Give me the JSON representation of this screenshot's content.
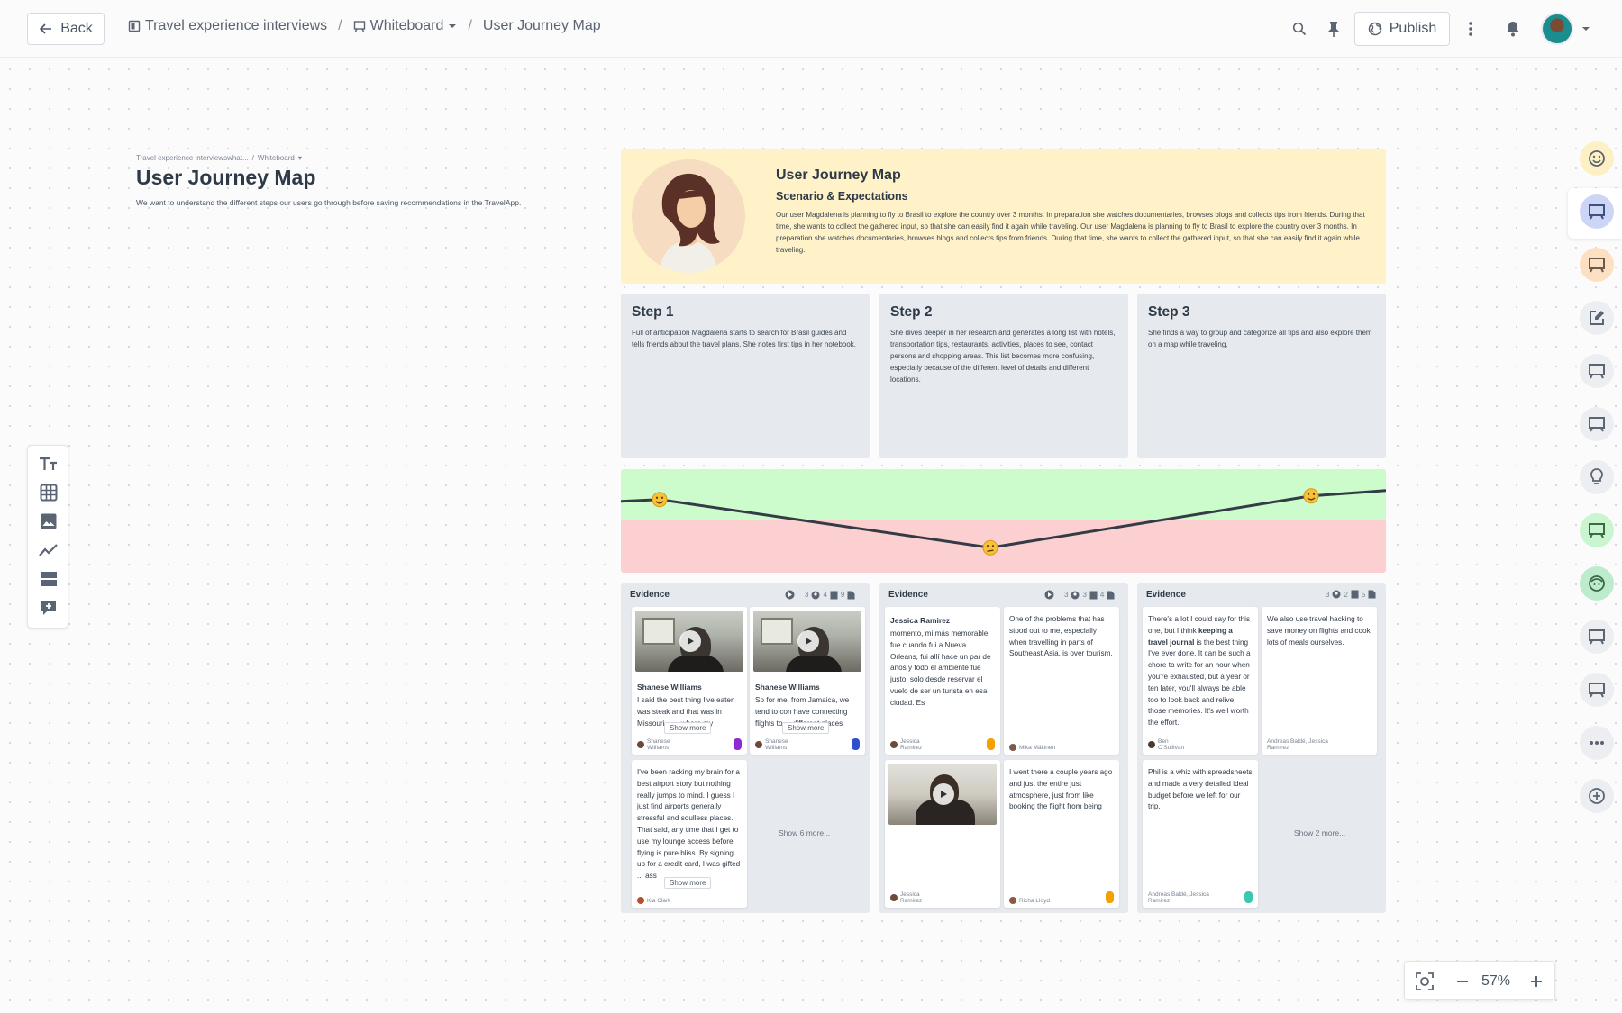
{
  "topbar": {
    "back_label": "Back",
    "breadcrumbs": [
      "Travel experience interviews",
      "Whiteboard",
      "User Journey Map"
    ],
    "publish_label": "Publish"
  },
  "page": {
    "mini_crumbs": [
      "Travel experience interviewswhat...",
      "Whiteboard"
    ],
    "title": "User Journey Map",
    "description": "We want to understand the different steps our users go through before saving recommendations in the TravelApp."
  },
  "scenario": {
    "title": "User Journey Map",
    "subtitle": "Scenario & Expectations",
    "text": "Our user Magdalena is planning to fly to Brasil to explore the country over 3 months. In preparation she watches documentaries, browses blogs and collects tips from friends. During that time, she wants to collect the gathered input, so that she can easily find it again while traveling. Our user Magdalena is planning to fly to Brasil to explore the country over 3 months. In  preparation she watches documentaries, browses blogs and collects tips from friends. During that time, she wants to collect the gathered input, so that she can easily find it again while traveling."
  },
  "steps": [
    {
      "title": "Step 1",
      "text": "Full of anticipation Magdalena starts to search for Brasil guides and tells friends about the travel plans. She notes first tips in her notebook."
    },
    {
      "title": "Step 2",
      "text": "She dives deeper in her research and generates a long list with hotels, transportation tips, restaurants, activities, places to see, contact persons and shopping areas. This list becomes more confusing, especially because of the different level of details and different locations."
    },
    {
      "title": "Step 3",
      "text": "She finds a way to group and categorize all tips and also explore them on a map while traveling."
    }
  ],
  "emotion_curve": {
    "values": [
      0.74,
      0.2,
      0.78
    ]
  },
  "evidence": [
    {
      "title": "Evidence",
      "meta": {
        "videos": "",
        "people": "3",
        "people2": "4",
        "notes": "9"
      },
      "cards": [
        {
          "author": "Shanese Williams",
          "text": "I said the best thing I've eaten was steak and that was in Missouri, , ... where my",
          "foot": "Shanese Williams",
          "show_more": "Show more"
        },
        {
          "author": "Shanese Williams",
          "text": "So for me, from Jamaica, we tend to con have connecting flights to ... different places",
          "foot": "Shanese Williams",
          "show_more": "Show more"
        },
        {
          "text": "I've been racking my brain for a best airport story but nothing really jumps to mind. I guess I just find airports generally stressful and soulless places. That said, any time that I get to use my lounge access before flying is pure bliss. By signing up for a credit card, I was gifted ... ass",
          "foot": "Kia Clark",
          "show_more": "Show more"
        }
      ],
      "show_more_link": "Show 6 more..."
    },
    {
      "title": "Evidence",
      "meta": {
        "people": "3",
        "people2": "3",
        "notes": "4"
      },
      "cards": [
        {
          "author": "Jessica Ramirez",
          "text": "momento, mi más memorable fue cuando fui a Nueva Orleans, fui allí hace un par de años y todo el ambiente fue justo, solo desde reservar el vuelo de ser un turista en esa ciudad. Es",
          "foot": "Jessica Ramirez"
        },
        {
          "text": "One of the problems that has stood out to me, especially when travelling in parts of Southeast Asia, is over tourism.",
          "foot": "Mika Mäkinen"
        },
        {
          "text": "",
          "foot": "Jessica Ramirez"
        },
        {
          "text": "I went there a couple years ago and just the entire just atmosphere, just from like booking the flight from being",
          "foot": "Richa Lloyd"
        }
      ]
    },
    {
      "title": "Evidence",
      "meta": {
        "people": "3",
        "people2": "2",
        "notes": "5"
      },
      "cards": [
        {
          "text_before": "There's a lot I could say for this one, but I think ",
          "text_bold": "keeping a travel journal",
          "text_after": " is the best thing I've ever done. It can be such a chore to write for an hour when you're exhausted, but a year or ten later, you'll always be able too to look back and relive those memories. It's well worth the effort.",
          "foot": "Ben O'Sullivan"
        },
        {
          "text": "We also use travel hacking to save money on flights and cook lots of meals ourselves.",
          "foot": "Andreas Baldé, Jessica Ramirez"
        },
        {
          "text": "Phil is a whiz with spreadsheets and made a very detailed ideal budget before we left for our trip.",
          "foot": "Andreas Baldé, Jessica Ramirez"
        }
      ],
      "show_more_link": "Show 2 more..."
    }
  ],
  "zoom": {
    "value": "57%"
  },
  "colors": {
    "scenario_bg": "#fff2c8",
    "positive": "#ccfbcc",
    "negative": "#fcd0d0",
    "tag_purple": "#8e2bd1",
    "tag_blue": "#2d4fd0",
    "tag_orange": "#f5a000",
    "tag_teal": "#3cc7b0"
  }
}
